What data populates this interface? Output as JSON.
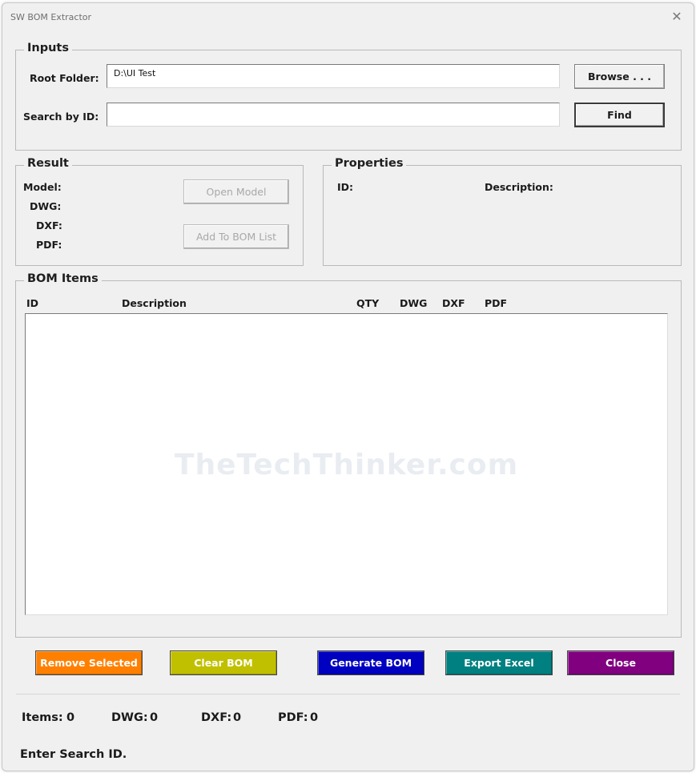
{
  "window": {
    "title": "SW BOM Extractor",
    "close_glyph": "✕"
  },
  "inputs": {
    "legend": "Inputs",
    "root_folder_label": "Root Folder:",
    "root_folder_value": "D:\\UI Test",
    "search_label": "Search by ID:",
    "search_value": "",
    "browse_label": "Browse . . .",
    "find_label": "Find"
  },
  "result": {
    "legend": "Result",
    "model_label": "Model:",
    "dwg_label": "DWG:",
    "dxf_label": "DXF:",
    "pdf_label": "PDF:",
    "open_model_label": "Open Model",
    "add_to_bom_label": "Add To BOM List"
  },
  "properties": {
    "legend": "Properties",
    "id_label": "ID:",
    "description_label": "Description:"
  },
  "bom": {
    "legend": "BOM Items",
    "columns": [
      "ID",
      "Description",
      "QTY",
      "DWG",
      "DXF",
      "PDF"
    ],
    "rows": [],
    "watermark": "TheTechThinker.com"
  },
  "actions": {
    "remove_selected": "Remove Selected",
    "clear_bom": "Clear BOM",
    "generate_bom": "Generate BOM",
    "export_excel": "Export Excel",
    "close": "Close"
  },
  "colors": {
    "remove_selected": "#ff8000",
    "clear_bom": "#c0c000",
    "generate_bom": "#0000c0",
    "export_excel": "#008080",
    "close": "#800080"
  },
  "stats": {
    "items_label": "Items:",
    "items_value": "0",
    "dwg_label": "DWG:",
    "dwg_value": "0",
    "dxf_label": "DXF:",
    "dxf_value": "0",
    "pdf_label": "PDF:",
    "pdf_value": "0"
  },
  "status": {
    "message": "Enter Search ID."
  }
}
